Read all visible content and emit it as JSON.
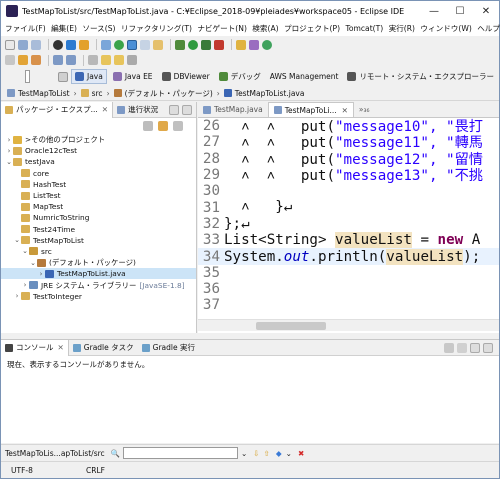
{
  "window": {
    "title": "TestMapToList/src/TestMapToList.java - C:¥Eclipse_2018-09¥pleiades¥workspace05 - Eclipse IDE",
    "minimize": "—",
    "maximize": "☐",
    "close": "✕"
  },
  "menu": [
    "ファイル(F)",
    "編集(E)",
    "ソース(S)",
    "リファクタリング(T)",
    "ナビゲート(N)",
    "検索(A)",
    "プロジェクト(P)",
    "Tomcat(T)",
    "実行(R)",
    "ウィンドウ(W)",
    "ヘルプ(H)"
  ],
  "perspectives": {
    "quick_access": "クイック・アクセス",
    "items": [
      {
        "label": "Java",
        "active": true,
        "color": "#3b66b4"
      },
      {
        "label": "Java EE",
        "active": false,
        "color": "#8a6fb0"
      },
      {
        "label": "DBViewer",
        "active": false,
        "color": "#555555"
      },
      {
        "label": "デバッグ",
        "active": false,
        "color": "#4f8a3a"
      },
      {
        "label": "AWS Management",
        "active": false,
        "color": "#e08a1e"
      },
      {
        "label": "リモート・システム・エクスプローラー",
        "active": false,
        "color": "#555555"
      }
    ]
  },
  "breadcrumb": [
    "TestMapToList",
    "src",
    "(デフォルト・パッケージ)",
    "TestMapToList.java"
  ],
  "explorer": {
    "tabs": [
      "パッケージ・エクスプ...",
      "進行状況"
    ],
    "tree": [
      {
        "label": "その他のプロジェクト",
        "prefix": ">",
        "twisty": "›",
        "icon": "working-set",
        "depth": 0
      },
      {
        "label": "Oracle12cTest",
        "prefix": "",
        "twisty": "›",
        "icon": "project",
        "depth": 0
      },
      {
        "label": "testJava",
        "prefix": "",
        "twisty": "⌄",
        "icon": "project",
        "depth": 0
      },
      {
        "label": "core",
        "prefix": "",
        "twisty": "",
        "icon": "project",
        "depth": 1
      },
      {
        "label": "HashTest",
        "prefix": "",
        "twisty": "",
        "icon": "project",
        "depth": 1
      },
      {
        "label": "ListTest",
        "prefix": "",
        "twisty": "",
        "icon": "project",
        "depth": 1
      },
      {
        "label": "MapTest",
        "prefix": "",
        "twisty": "",
        "icon": "project",
        "depth": 1
      },
      {
        "label": "NumricToString",
        "prefix": "",
        "twisty": "",
        "icon": "project",
        "depth": 1
      },
      {
        "label": "Test24Time",
        "prefix": "",
        "twisty": "",
        "icon": "project",
        "depth": 1
      },
      {
        "label": "TestMapToList",
        "prefix": "",
        "twisty": "⌄",
        "icon": "project",
        "depth": 1
      },
      {
        "label": "src",
        "prefix": "",
        "twisty": "⌄",
        "icon": "source-folder",
        "depth": 2
      },
      {
        "label": "(デフォルト・パッケージ)",
        "prefix": "",
        "twisty": "⌄",
        "icon": "package",
        "depth": 3
      },
      {
        "label": "TestMapToList.java",
        "prefix": "",
        "twisty": "›",
        "icon": "java-file",
        "depth": 4,
        "selected": true
      },
      {
        "label": "JRE システム・ライブラリー",
        "prefix": "",
        "twisty": "›",
        "icon": "library",
        "depth": 2,
        "decoration": "[JavaSE-1.8]"
      },
      {
        "label": "TestToInteger",
        "prefix": "",
        "twisty": "›",
        "icon": "project",
        "depth": 1
      }
    ]
  },
  "editor": {
    "tabs": [
      {
        "label": "TestMap.java",
        "active": false
      },
      {
        "label": "TestMapToLi...",
        "active": true
      },
      {
        "label": "»₃₆",
        "active": false
      }
    ],
    "lines": [
      {
        "n": "26",
        "pre": "  ˄  ˄   put(",
        "str": "\"message10\", \"畏打",
        "post": ""
      },
      {
        "n": "27",
        "pre": "  ˄  ˄   put(",
        "str": "\"message11\", \"轉馬",
        "post": ""
      },
      {
        "n": "28",
        "pre": "  ˄  ˄   put(",
        "str": "\"message12\", \"留情",
        "post": ""
      },
      {
        "n": "29",
        "pre": "  ˄  ˄   put(",
        "str": "\"message13\", \"不挑",
        "post": ""
      },
      {
        "n": "30",
        "pre": "",
        "str": "",
        "post": ""
      },
      {
        "n": "31",
        "pre": "  ˄   }↵",
        "str": "",
        "post": ""
      },
      {
        "n": "32",
        "pre": "};↵",
        "str": "",
        "post": ""
      },
      {
        "n": "33",
        "decl": {
          "type": "List<String> ",
          "var": "valueList",
          "rest": " = ",
          "kw": "new",
          "tail": " A"
        }
      },
      {
        "n": "34",
        "call": {
          "a": "System.",
          "field": "out",
          "b": ".println(",
          "arg": "valueList",
          "c": ");"
        }
      },
      {
        "n": "35",
        "pre": "",
        "str": "",
        "post": ""
      },
      {
        "n": "36",
        "pre": "",
        "str": "",
        "post": ""
      },
      {
        "n": "37",
        "pre": "",
        "str": "",
        "post": ""
      }
    ]
  },
  "console": {
    "tabs": [
      "コンソール",
      "Gradle タスク",
      "Gradle 実行"
    ],
    "message": "現在、表示するコンソールがありません。"
  },
  "findbar": {
    "path": "TestMapToLis...apToList/src"
  },
  "status": {
    "encoding": "UTF-8",
    "line_ending": "CRLF"
  },
  "colors": {
    "selection": "#cce4f7",
    "keyword": "#7f0055",
    "string": "#2a00ff",
    "accent": "#3b66b4"
  }
}
